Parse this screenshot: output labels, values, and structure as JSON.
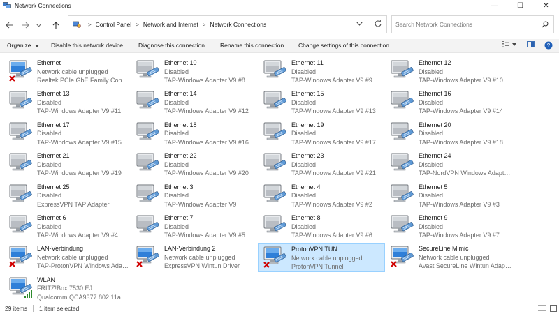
{
  "window": {
    "title": "Network Connections",
    "minimize_glyph": "—",
    "maximize_glyph": "☐",
    "close_glyph": "✕"
  },
  "address": {
    "breadcrumbs": [
      "Control Panel",
      "Network and Internet",
      "Network Connections"
    ],
    "search_placeholder": "Search Network Connections"
  },
  "commands": {
    "organize": "Organize",
    "disable": "Disable this network device",
    "diagnose": "Diagnose this connection",
    "rename": "Rename this connection",
    "change_settings": "Change settings of this connection"
  },
  "connections": [
    {
      "name": "Ethernet",
      "status": "Network cable unplugged",
      "device": "Realtek PCIe GbE Family Controller",
      "type": "ethernet",
      "state": "unplugged"
    },
    {
      "name": "Ethernet 10",
      "status": "Disabled",
      "device": "TAP-Windows Adapter V9 #8",
      "type": "ethernet",
      "state": "disabled"
    },
    {
      "name": "Ethernet 11",
      "status": "Disabled",
      "device": "TAP-Windows Adapter V9 #9",
      "type": "ethernet",
      "state": "disabled"
    },
    {
      "name": "Ethernet 12",
      "status": "Disabled",
      "device": "TAP-Windows Adapter V9 #10",
      "type": "ethernet",
      "state": "disabled"
    },
    {
      "name": "Ethernet 13",
      "status": "Disabled",
      "device": "TAP-Windows Adapter V9 #11",
      "type": "ethernet",
      "state": "disabled"
    },
    {
      "name": "Ethernet 14",
      "status": "Disabled",
      "device": "TAP-Windows Adapter V9 #12",
      "type": "ethernet",
      "state": "disabled"
    },
    {
      "name": "Ethernet 15",
      "status": "Disabled",
      "device": "TAP-Windows Adapter V9 #13",
      "type": "ethernet",
      "state": "disabled"
    },
    {
      "name": "Ethernet 16",
      "status": "Disabled",
      "device": "TAP-Windows Adapter V9 #14",
      "type": "ethernet",
      "state": "disabled"
    },
    {
      "name": "Ethernet 17",
      "status": "Disabled",
      "device": "TAP-Windows Adapter V9 #15",
      "type": "ethernet",
      "state": "disabled"
    },
    {
      "name": "Ethernet 18",
      "status": "Disabled",
      "device": "TAP-Windows Adapter V9 #16",
      "type": "ethernet",
      "state": "disabled"
    },
    {
      "name": "Ethernet 19",
      "status": "Disabled",
      "device": "TAP-Windows Adapter V9 #17",
      "type": "ethernet",
      "state": "disabled"
    },
    {
      "name": "Ethernet 20",
      "status": "Disabled",
      "device": "TAP-Windows Adapter V9 #18",
      "type": "ethernet",
      "state": "disabled"
    },
    {
      "name": "Ethernet 21",
      "status": "Disabled",
      "device": "TAP-Windows Adapter V9 #19",
      "type": "ethernet",
      "state": "disabled"
    },
    {
      "name": "Ethernet 22",
      "status": "Disabled",
      "device": "TAP-Windows Adapter V9 #20",
      "type": "ethernet",
      "state": "disabled"
    },
    {
      "name": "Ethernet 23",
      "status": "Disabled",
      "device": "TAP-Windows Adapter V9 #21",
      "type": "ethernet",
      "state": "disabled"
    },
    {
      "name": "Ethernet 24",
      "status": "Disabled",
      "device": "TAP-NordVPN Windows Adapter ...",
      "type": "ethernet",
      "state": "disabled"
    },
    {
      "name": "Ethernet 25",
      "status": "Disabled",
      "device": "ExpressVPN TAP Adapter",
      "type": "ethernet",
      "state": "disabled"
    },
    {
      "name": "Ethernet 3",
      "status": "Disabled",
      "device": "TAP-Windows Adapter V9",
      "type": "ethernet",
      "state": "disabled"
    },
    {
      "name": "Ethernet 4",
      "status": "Disabled",
      "device": "TAP-Windows Adapter V9 #2",
      "type": "ethernet",
      "state": "disabled"
    },
    {
      "name": "Ethernet 5",
      "status": "Disabled",
      "device": "TAP-Windows Adapter V9 #3",
      "type": "ethernet",
      "state": "disabled"
    },
    {
      "name": "Ethernet 6",
      "status": "Disabled",
      "device": "TAP-Windows Adapter V9 #4",
      "type": "ethernet",
      "state": "disabled"
    },
    {
      "name": "Ethernet 7",
      "status": "Disabled",
      "device": "TAP-Windows Adapter V9 #5",
      "type": "ethernet",
      "state": "disabled"
    },
    {
      "name": "Ethernet 8",
      "status": "Disabled",
      "device": "TAP-Windows Adapter V9 #6",
      "type": "ethernet",
      "state": "disabled"
    },
    {
      "name": "Ethernet 9",
      "status": "Disabled",
      "device": "TAP-Windows Adapter V9 #7",
      "type": "ethernet",
      "state": "disabled"
    },
    {
      "name": "LAN-Verbindung",
      "status": "Network cable unplugged",
      "device": "TAP-ProtonVPN Windows Adapte...",
      "type": "ethernet",
      "state": "unplugged"
    },
    {
      "name": "LAN-Verbindung 2",
      "status": "Network cable unplugged",
      "device": "ExpressVPN Wintun Driver",
      "type": "ethernet",
      "state": "unplugged"
    },
    {
      "name": "ProtonVPN TUN",
      "status": "Network cable unplugged",
      "device": "ProtonVPN Tunnel",
      "type": "ethernet",
      "state": "unplugged",
      "selected": true
    },
    {
      "name": "SecureLine Mimic",
      "status": "Network cable unplugged",
      "device": "Avast SecureLine Wintun Adapter",
      "type": "ethernet",
      "state": "unplugged"
    },
    {
      "name": "WLAN",
      "status": "FRITZ!Box 7530 EJ",
      "device": "Qualcomm QCA9377 802.11ac W...",
      "type": "wifi",
      "state": "connected"
    }
  ],
  "status": {
    "item_count": "29 items",
    "selected_count": "1 item selected"
  },
  "colors": {
    "selection_bg": "#cce8ff",
    "selection_border": "#99d1ff",
    "error_red": "#d10000",
    "signal_green": "#2e8b2e"
  }
}
